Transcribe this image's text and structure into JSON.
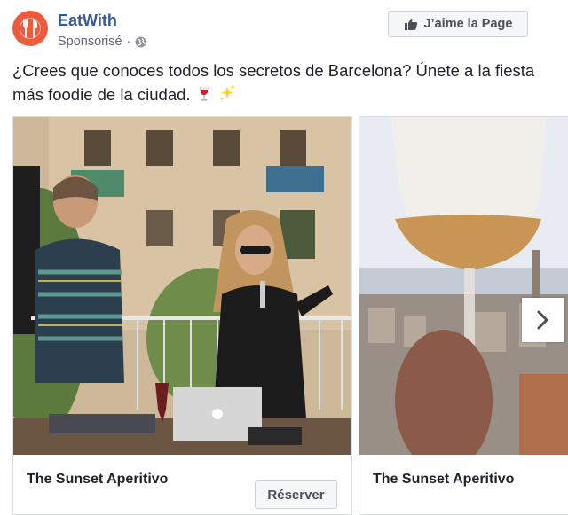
{
  "post": {
    "page_name": "EatWith",
    "sponsored_label": "Sponsorisé",
    "sponsored_separator": "·",
    "like_page_label": "J’aime la Page",
    "text": "¿Crees que conoces todos los secretos de Barcelona? Únete a la fiesta más foodie de la ciudad.",
    "emojis": [
      "wine-glass-emoji",
      "sparkles-emoji"
    ]
  },
  "carousel": {
    "cards": [
      {
        "title": "The Sunset Aperitivo",
        "cta_label": "Réserver",
        "image": "rooftop-dj-performance-photo"
      },
      {
        "title": "The Sunset Aperitivo",
        "image": "wine-glass-barcelona-view-photo"
      }
    ],
    "next_icon": "chevron-right-icon"
  },
  "colors": {
    "brand_orange": "#ee5a3c",
    "link_blue": "#365899",
    "text_dark": "#1d2129",
    "text_muted": "#616770"
  }
}
